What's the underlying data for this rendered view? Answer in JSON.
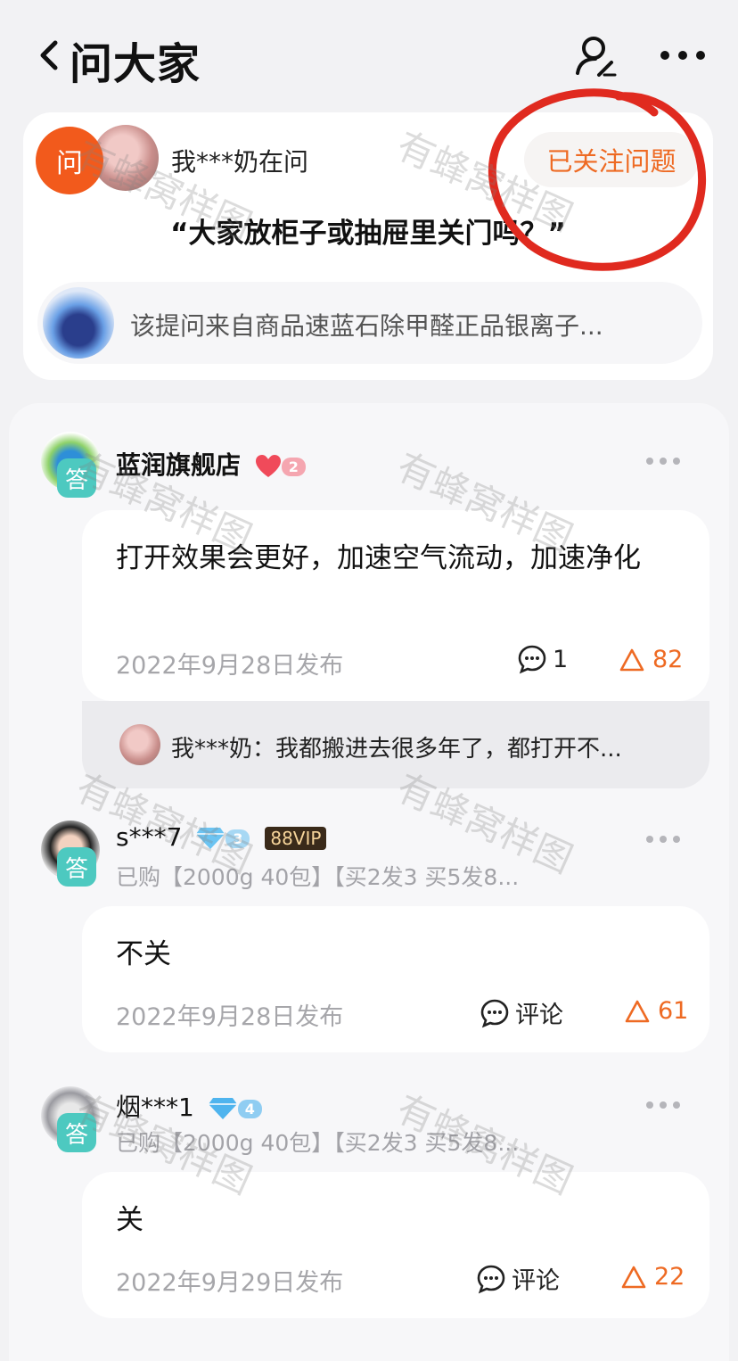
{
  "header": {
    "title": "问大家"
  },
  "question": {
    "ask_badge": "问",
    "asker": "我***奶在问",
    "follow_label": "已关注问题",
    "text": "“大家放柜子或抽屉里关门吗？”",
    "product_text": "该提问来自商品速蓝石除甲醛正品银离子..."
  },
  "answers": [
    {
      "badge": "答",
      "name": "蓝润旗舰店",
      "level": "2",
      "text": "打开效果会更好，加速空气流动，加速净化",
      "date": "2022年9月28日发布",
      "comments": "1",
      "likes": "82",
      "reply": "我***奶：我都搬进去很多年了，都打开不..."
    },
    {
      "badge": "答",
      "name": "s***7",
      "level": "3",
      "vip": "88VIP",
      "bought": "已购【2000g 40包】【买2发3 买5发8...",
      "text": "不关",
      "date": "2022年9月28日发布",
      "comments": "评论",
      "likes": "61"
    },
    {
      "badge": "答",
      "name": "烟***1",
      "level": "4",
      "bought": "已购【2000g 40包】【买2发3 买5发8...",
      "text": "关",
      "date": "2022年9月29日发布",
      "comments": "评论",
      "likes": "22"
    }
  ],
  "watermark": "有蜂窝样图",
  "colors": {
    "accent": "#ee6a23",
    "ask_badge": "#f25a1c",
    "answer_badge": "#4dc9c0",
    "annotation": "#e02a1f"
  }
}
